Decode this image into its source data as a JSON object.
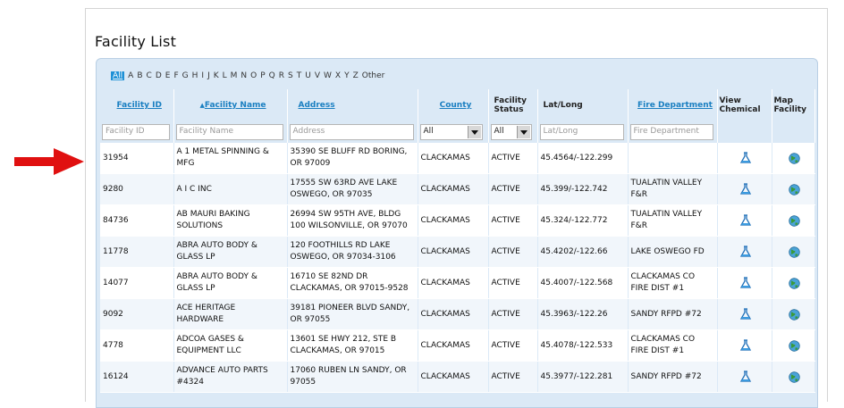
{
  "page": {
    "title": "Facility List"
  },
  "alphabet": [
    "All",
    "A",
    "B",
    "C",
    "D",
    "E",
    "F",
    "G",
    "H",
    "I",
    "J",
    "K",
    "L",
    "M",
    "N",
    "O",
    "P",
    "Q",
    "R",
    "S",
    "T",
    "U",
    "V",
    "W",
    "X",
    "Y",
    "Z",
    "Other"
  ],
  "columns": {
    "facility_id": "Facility ID",
    "facility_name": "Facility Name",
    "address": "Address",
    "county": "County",
    "status_line1": "Facility",
    "status_line2": "Status",
    "latlong": "Lat/Long",
    "fire_department": "Fire Department",
    "view_line1": "View",
    "view_line2": "Chemical",
    "map_line1": "Map",
    "map_line2": "Facility"
  },
  "filters": {
    "facility_id_placeholder": "Facility ID",
    "facility_name_placeholder": "Facility Name",
    "address_placeholder": "Address",
    "county_value": "All",
    "status_value": "All",
    "latlong_placeholder": "Lat/Long",
    "fire_department_placeholder": "Fire Department"
  },
  "rows": [
    {
      "id": "31954",
      "name1": "A 1 METAL SPINNING &",
      "name2": "MFG",
      "addr1": "35390 SE BLUFF RD BORING,",
      "addr2": "OR 97009",
      "county": "CLACKAMAS",
      "status": "ACTIVE",
      "latlong": "45.4564/-122.299",
      "fire1": "",
      "fire2": ""
    },
    {
      "id": "9280",
      "name1": "A I C INC",
      "name2": "",
      "addr1": "17555 SW 63RD AVE LAKE",
      "addr2": "OSWEGO, OR 97035",
      "county": "CLACKAMAS",
      "status": "ACTIVE",
      "latlong": "45.399/-122.742",
      "fire1": "TUALATIN VALLEY",
      "fire2": "F&R"
    },
    {
      "id": "84736",
      "name1": "AB MAURI BAKING",
      "name2": "SOLUTIONS",
      "addr1": "26994 SW 95TH AVE, BLDG",
      "addr2": "100 WILSONVILLE, OR 97070",
      "county": "CLACKAMAS",
      "status": "ACTIVE",
      "latlong": "45.324/-122.772",
      "fire1": "TUALATIN VALLEY",
      "fire2": "F&R"
    },
    {
      "id": "11778",
      "name1": "ABRA AUTO BODY &",
      "name2": "GLASS LP",
      "addr1": "120 FOOTHILLS RD LAKE",
      "addr2": "OSWEGO, OR 97034-3106",
      "county": "CLACKAMAS",
      "status": "ACTIVE",
      "latlong": "45.4202/-122.66",
      "fire1": "LAKE OSWEGO FD",
      "fire2": ""
    },
    {
      "id": "14077",
      "name1": "ABRA AUTO BODY &",
      "name2": "GLASS LP",
      "addr1": "16710 SE 82ND DR",
      "addr2": "CLACKAMAS, OR 97015-9528",
      "county": "CLACKAMAS",
      "status": "ACTIVE",
      "latlong": "45.4007/-122.568",
      "fire1": "CLACKAMAS CO",
      "fire2": "FIRE DIST #1"
    },
    {
      "id": "9092",
      "name1": "ACE HERITAGE",
      "name2": "HARDWARE",
      "addr1": "39181 PIONEER BLVD SANDY,",
      "addr2": "OR 97055",
      "county": "CLACKAMAS",
      "status": "ACTIVE",
      "latlong": "45.3963/-122.26",
      "fire1": "SANDY RFPD #72",
      "fire2": ""
    },
    {
      "id": "4778",
      "name1": "ADCOA GASES &",
      "name2": "EQUIPMENT LLC",
      "addr1": "13601 SE HWY 212, STE B",
      "addr2": "CLACKAMAS, OR 97015",
      "county": "CLACKAMAS",
      "status": "ACTIVE",
      "latlong": "45.4078/-122.533",
      "fire1": "CLACKAMAS CO",
      "fire2": "FIRE DIST #1"
    },
    {
      "id": "16124",
      "name1": "ADVANCE AUTO PARTS",
      "name2": "#4324",
      "addr1": "17060 RUBEN LN SANDY, OR",
      "addr2": "97055",
      "county": "CLACKAMAS",
      "status": "ACTIVE",
      "latlong": "45.3977/-122.281",
      "fire1": "SANDY RFPD #72",
      "fire2": ""
    }
  ],
  "colors": {
    "arrow": "#e01010",
    "link": "#1a7fc1",
    "header_bg": "#dbe9f6"
  }
}
